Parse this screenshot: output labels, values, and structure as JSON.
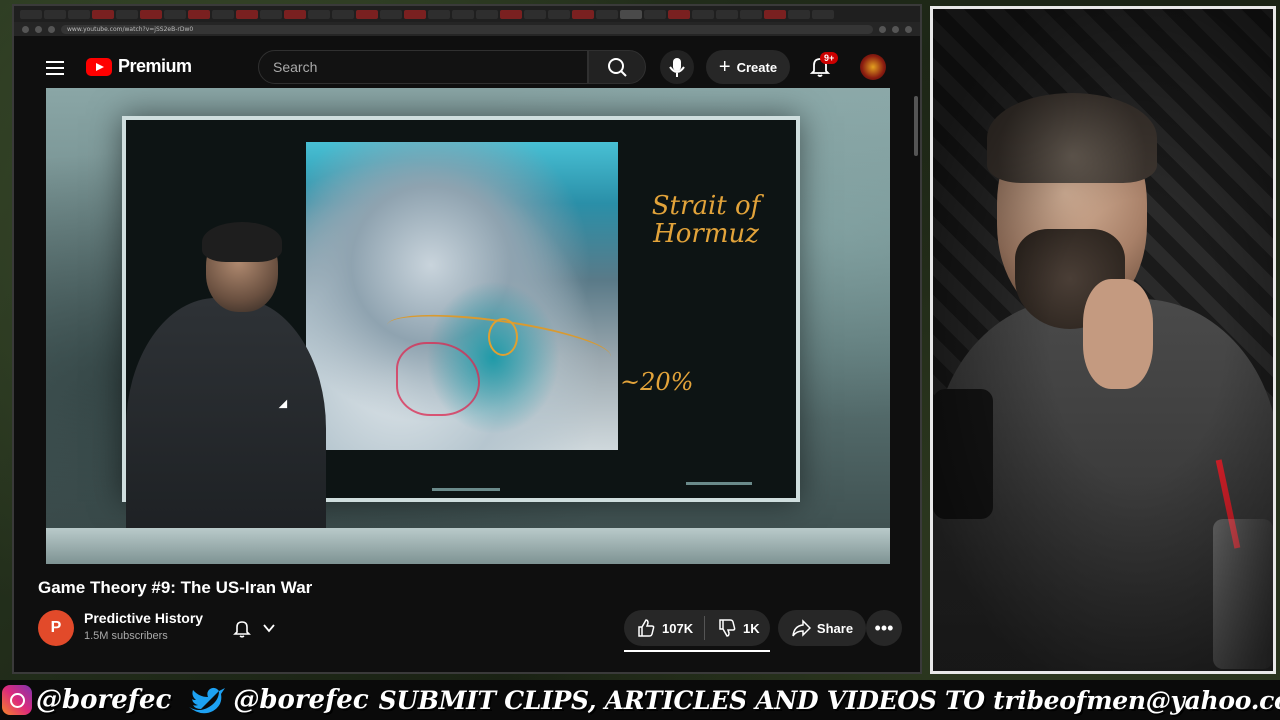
{
  "browser": {
    "url": "www.youtube.com/watch?v=jSS2eB-rDw0"
  },
  "header": {
    "logo_text": "Premium",
    "search_placeholder": "Search",
    "create_label": "Create",
    "notifications_badge": "9+"
  },
  "video": {
    "board_note_strait": "Strait of Hormuz",
    "board_note_pct": "~20%"
  },
  "meta": {
    "title": "Game Theory #9: The US-Iran War",
    "channel_initial": "P",
    "channel_name": "Predictive History",
    "subscribers": "1.5M subscribers",
    "likes": "107K",
    "dislikes": "1K",
    "share_label": "Share",
    "more_label": "•••"
  },
  "banner": {
    "instagram_handle": "@borefec",
    "twitter_handle": "@borefec",
    "message": "SUBMIT CLIPS, ARTICLES AND VIDEOS TO tribeofmen@yahoo.com"
  },
  "colors": {
    "youtube_red": "#ff0000",
    "background": "#0f0f0f",
    "board_ink": "#e2a33a"
  }
}
